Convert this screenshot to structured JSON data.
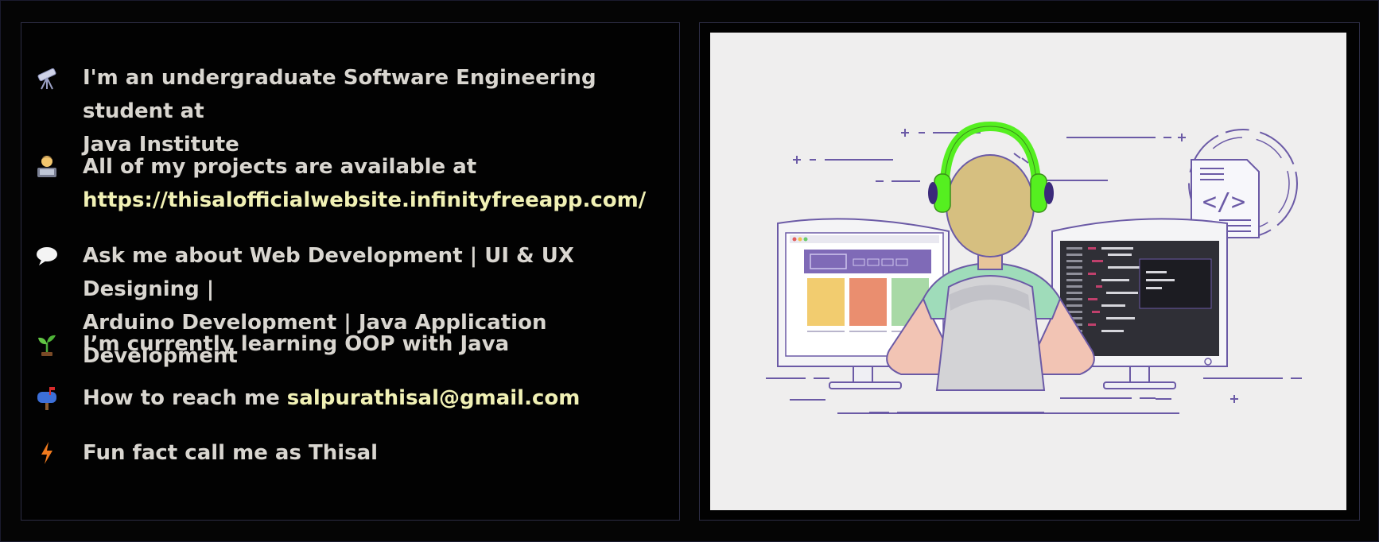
{
  "about": {
    "items": [
      {
        "icon": "telescope-icon",
        "text": "I'm an undergraduate Software Engineering student at",
        "text2": "Java Institute"
      },
      {
        "icon": "technologist-icon",
        "text": "All of my projects are available at",
        "link": "https://thisalofficialwebsite.infinityfreeapp.com/"
      },
      {
        "icon": "speech-bubble-icon",
        "text": "Ask me about Web Development | UI & UX Designing |",
        "text2": "Arduino Development | Java Application Development"
      },
      {
        "icon": "seedling-icon",
        "text": "I’m currently learning OOP with Java"
      },
      {
        "icon": "mailbox-icon",
        "text": "How to reach me ",
        "email": "salpurathisal@gmail.com"
      },
      {
        "icon": "lightning-icon",
        "text": "Fun fact call me as Thisal"
      }
    ]
  },
  "illustration": {
    "code_badge": "</>",
    "colors": {
      "accent_text": "#f1f1b5",
      "headphones": "#55ef20",
      "outline": "#6b5aa6",
      "body_text": "#d9d6d0"
    }
  }
}
